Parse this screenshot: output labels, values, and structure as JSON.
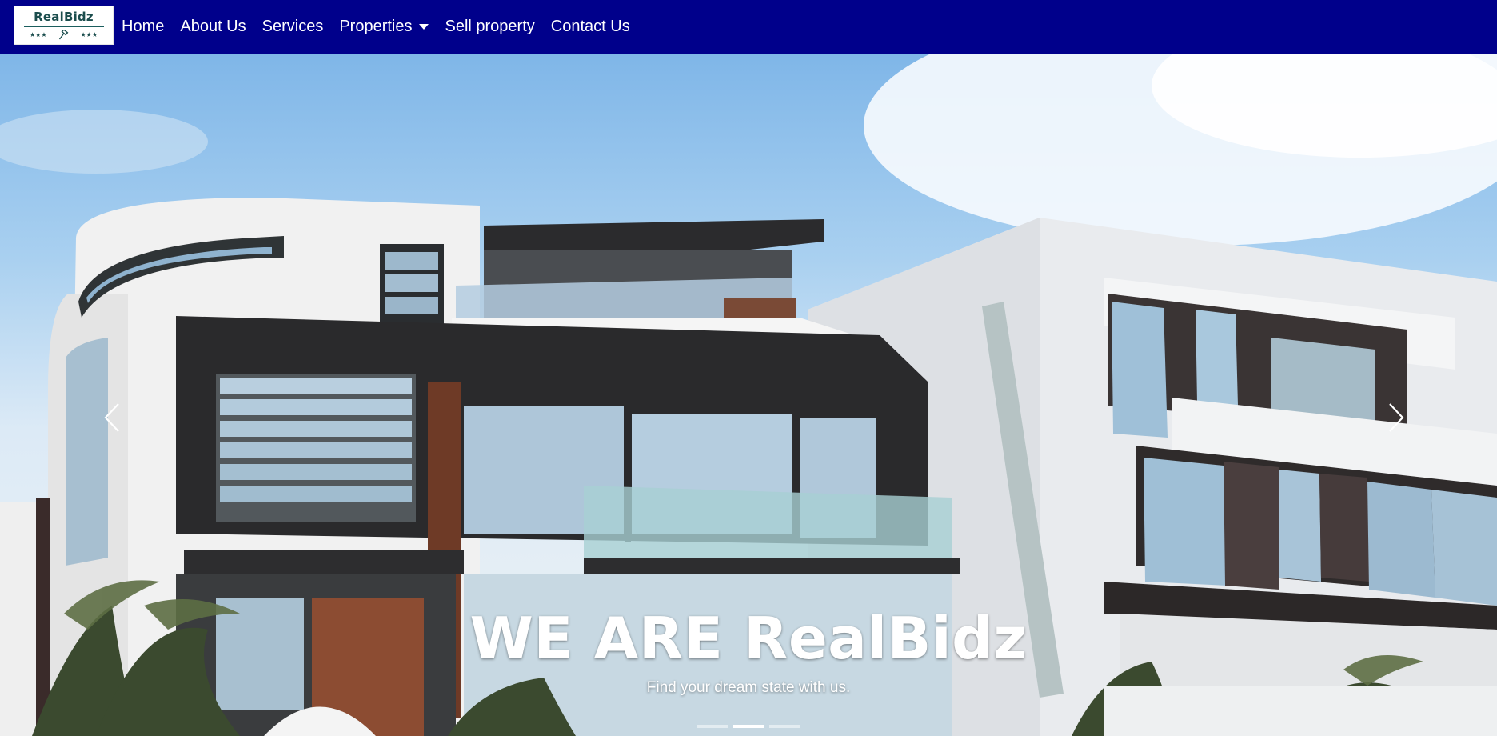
{
  "brand": {
    "name": "RealBidz",
    "stars_left": "★★★",
    "stars_right": "★★★"
  },
  "nav": {
    "home": "Home",
    "about": "About Us",
    "services": "Services",
    "properties": "Properties",
    "sell": "Sell property",
    "contact": "Contact Us"
  },
  "hero": {
    "title": "WE ARE RealBidz",
    "subtitle": "Find your dream state with us.",
    "slides_count": 3,
    "active_slide": 2
  },
  "colors": {
    "navbar": "#00008b",
    "text": "#ffffff"
  }
}
